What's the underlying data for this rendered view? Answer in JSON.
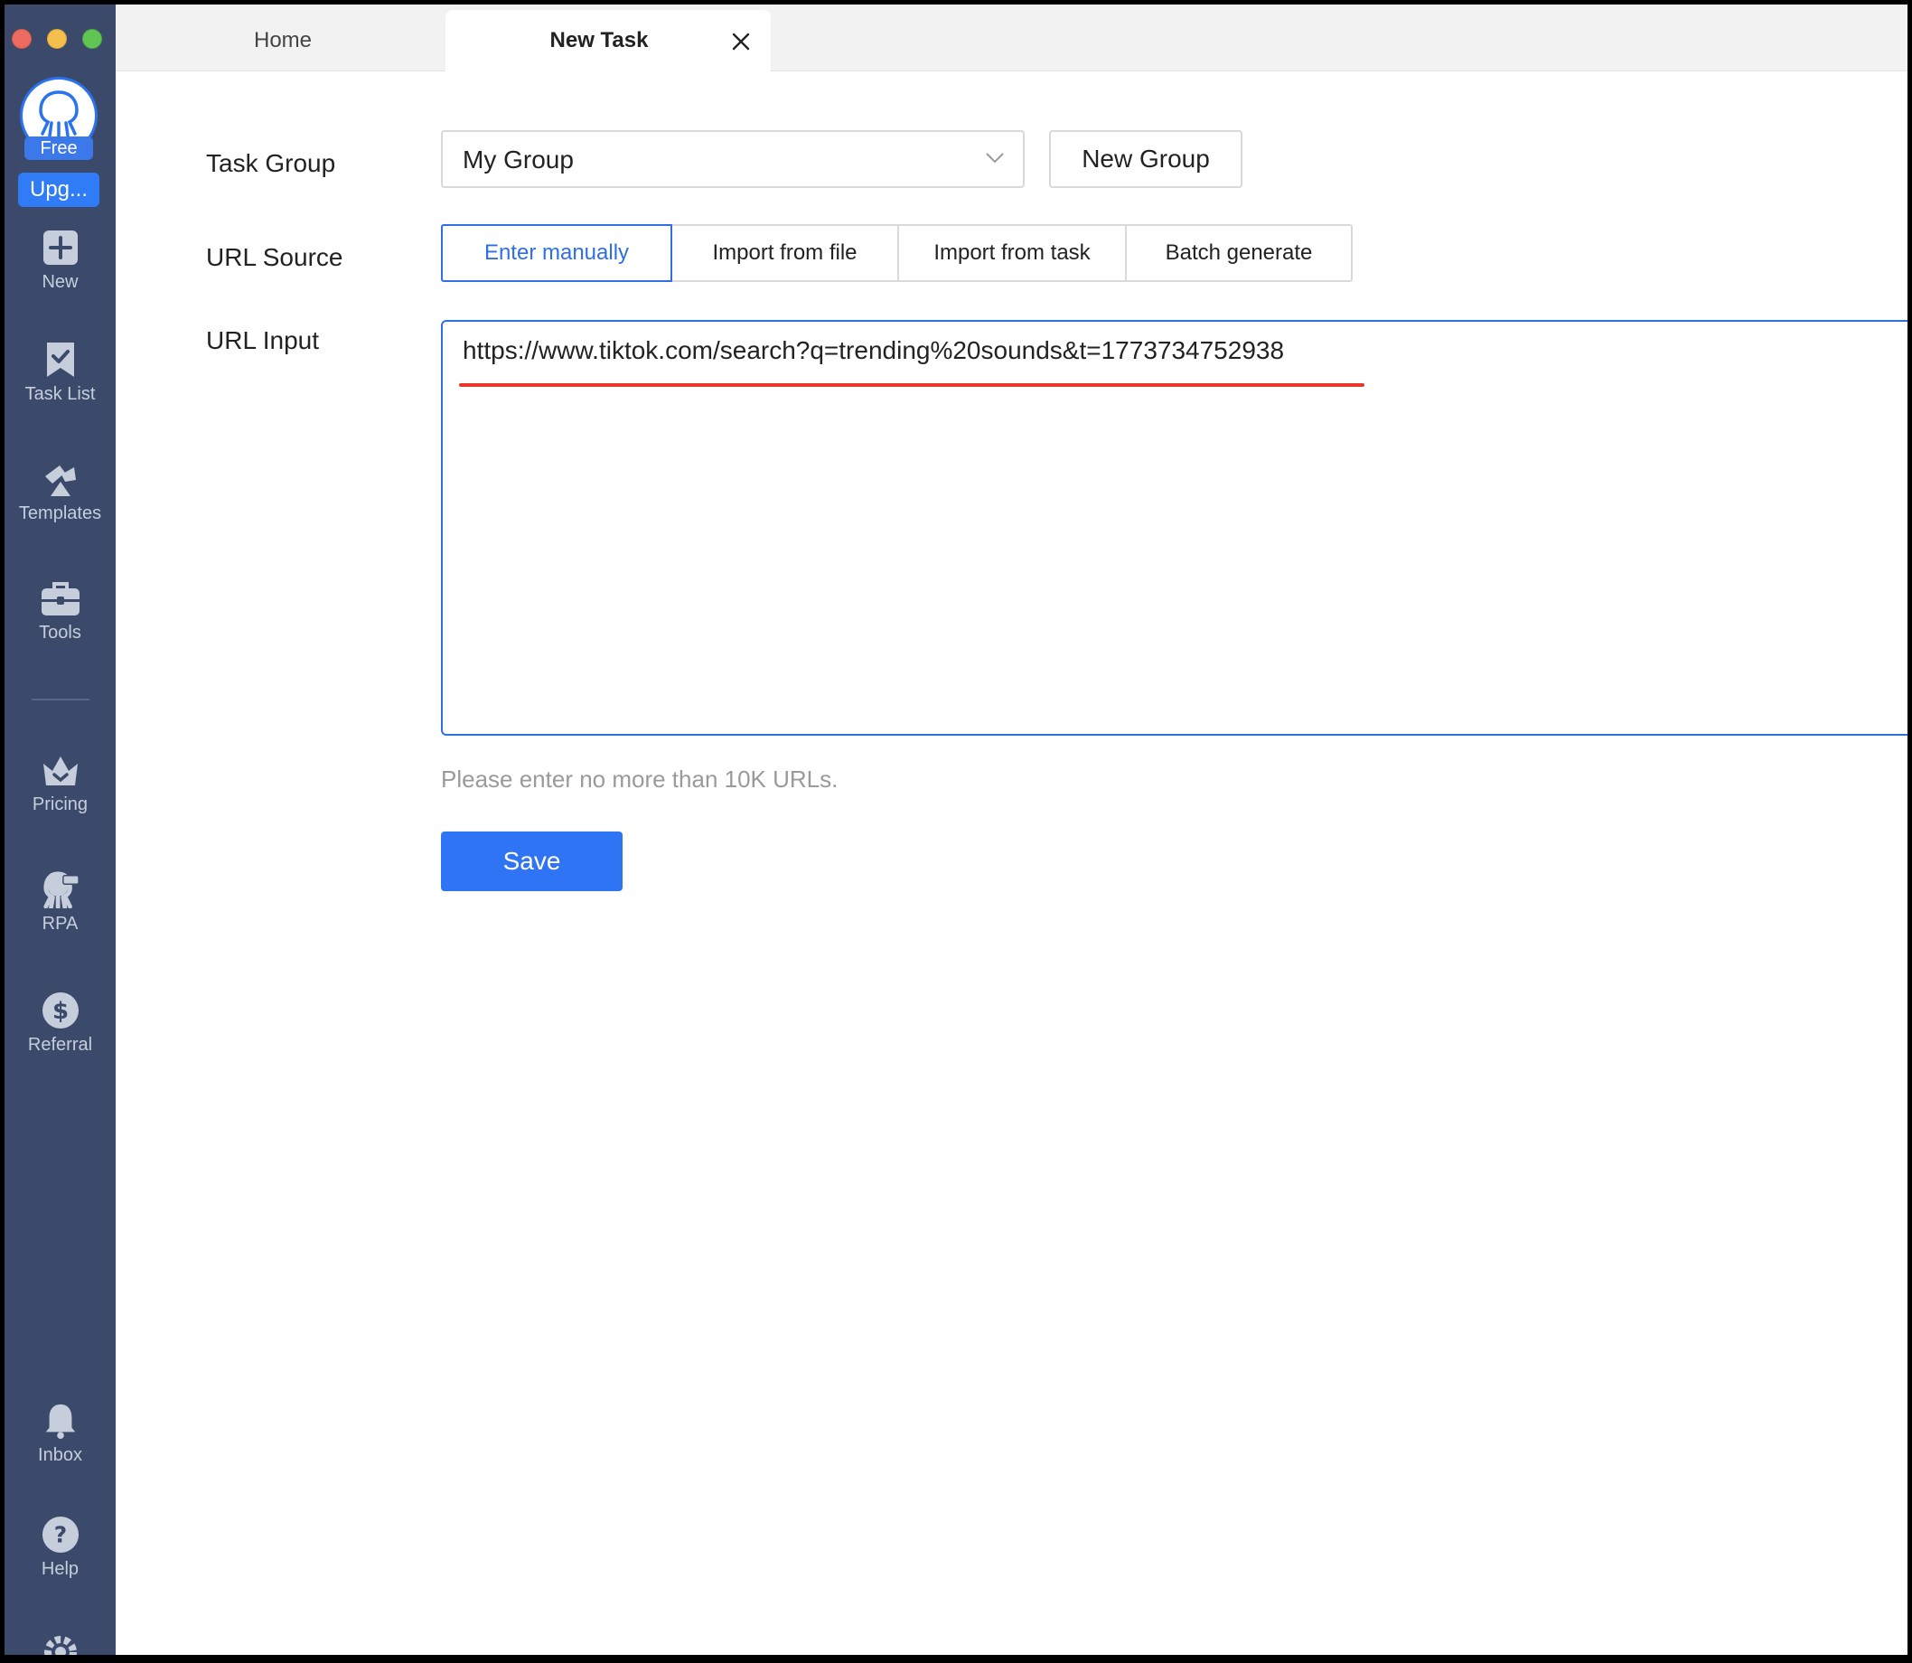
{
  "window_controls": {
    "close": "close",
    "minimize": "minimize",
    "zoom": "zoom"
  },
  "sidebar": {
    "plan_badge": "Free",
    "upgrade_label": "Upg...",
    "items": [
      {
        "label": "New",
        "icon": "plus-square-icon"
      },
      {
        "label": "Task List",
        "icon": "bookmark-check-icon"
      },
      {
        "label": "Templates",
        "icon": "templates-icon"
      },
      {
        "label": "Tools",
        "icon": "toolbox-icon"
      },
      {
        "label": "Pricing",
        "icon": "crown-icon"
      },
      {
        "label": "RPA",
        "icon": "rpa-octopus-icon"
      },
      {
        "label": "Referral",
        "icon": "dollar-icon"
      },
      {
        "label": "Inbox",
        "icon": "bell-icon"
      },
      {
        "label": "Help",
        "icon": "help-icon"
      }
    ],
    "colors": {
      "background": "#3b4a6b",
      "accent": "#2f7cf6"
    }
  },
  "tabs": [
    {
      "label": "Home",
      "active": false
    },
    {
      "label": "New Task",
      "active": true
    }
  ],
  "form": {
    "task_group": {
      "label": "Task Group",
      "value": "My Group",
      "new_group_label": "New Group"
    },
    "url_source": {
      "label": "URL Source",
      "options": [
        "Enter manually",
        "Import from file",
        "Import from task",
        "Batch generate"
      ],
      "selected": "Enter manually"
    },
    "url_input": {
      "label": "URL Input",
      "value": "https://www.tiktok.com/search?q=trending%20sounds&t=1773734752938",
      "hint": "Please enter no more than 10K URLs."
    },
    "save_label": "Save"
  },
  "colors": {
    "primary": "#2e74f5",
    "annotation_underline": "#e8382a"
  }
}
